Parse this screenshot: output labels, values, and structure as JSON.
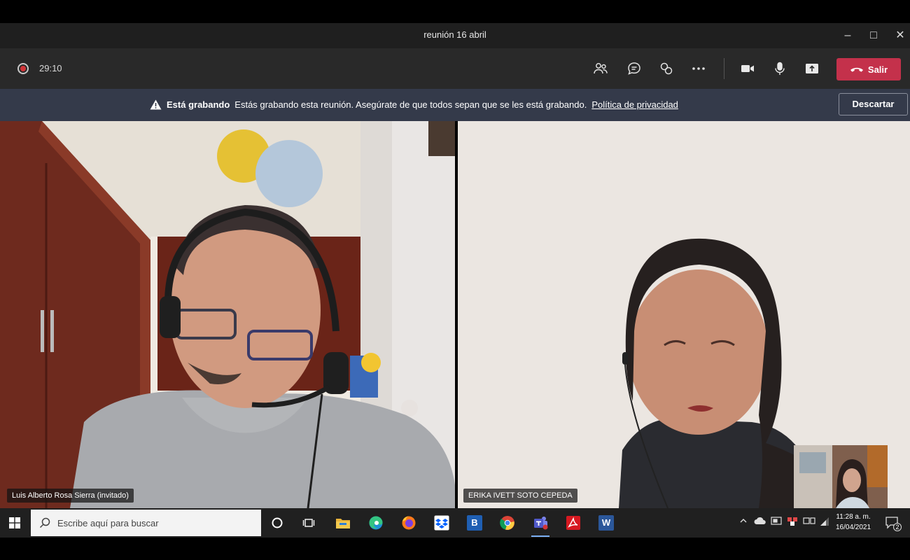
{
  "window": {
    "title": "reunión 16 abril",
    "controls": {
      "minimize": "–",
      "maximize": "□",
      "close": "✕"
    }
  },
  "toolbar": {
    "timer": "29:10",
    "leave_label": "Salir",
    "leave_color": "#c4314b",
    "icons": [
      "participants-icon",
      "chat-icon",
      "share-icon",
      "more-options-icon",
      "camera-icon",
      "microphone-icon",
      "share-tray-icon",
      "hangup-icon"
    ]
  },
  "banner": {
    "title": "Está grabando",
    "message": "Estás grabando esta reunión. Asegúrate de que todos sepan que se les está grabando.",
    "link": "Política de privacidad",
    "dismiss_label": "Descartar"
  },
  "participants": [
    {
      "name": "Luis Alberto Rosa Sierra (invitado)"
    },
    {
      "name": "ERIKA IVETT SOTO CEPEDA"
    }
  ],
  "taskbar": {
    "search_placeholder": "Escribe aquí para buscar",
    "apps": [
      "cortana-icon",
      "task-view-icon",
      "file-explorer-icon",
      "edge-icon",
      "firefox-icon",
      "dropbox-icon",
      "b-app-icon",
      "chrome-icon",
      "teams-icon",
      "acrobat-icon",
      "word-icon"
    ],
    "b_app_letter": "B",
    "word_letter": "W",
    "time": "11:28 a. m.",
    "date": "16/04/2021",
    "notification_count": "2"
  }
}
